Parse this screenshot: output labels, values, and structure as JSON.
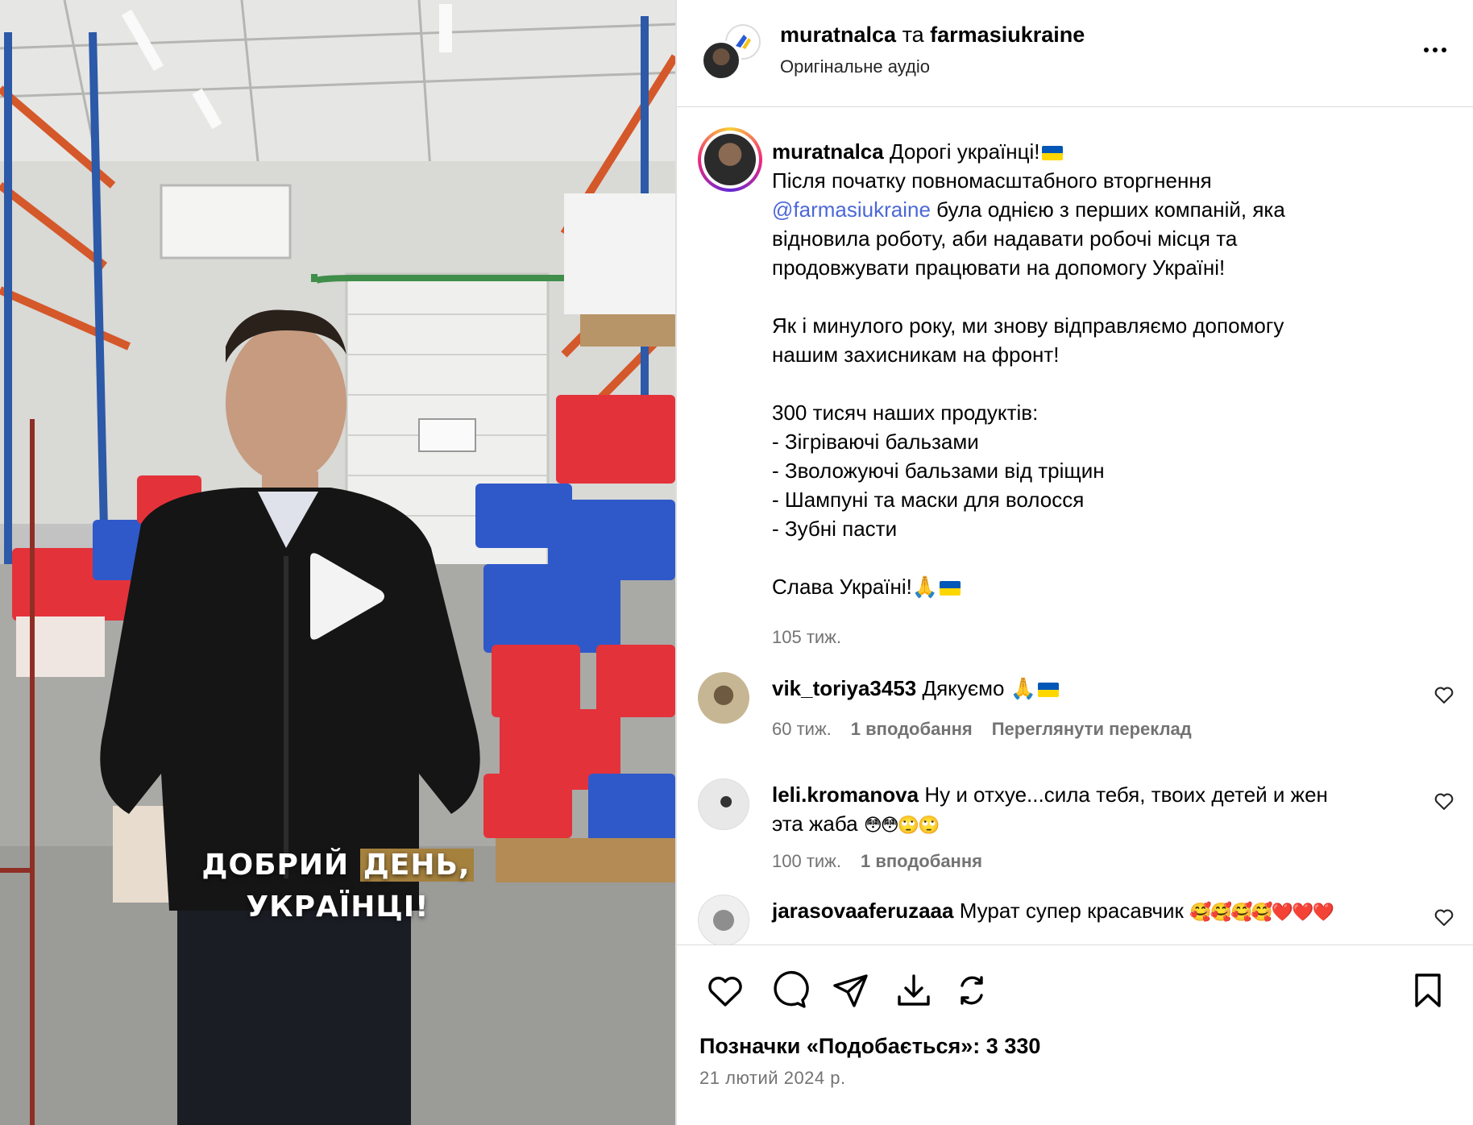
{
  "video": {
    "caption_line1_a": "ДОБРИЙ ",
    "caption_line1_b": "ДЕНЬ,",
    "caption_line2": "УКРАЇНЦІ!"
  },
  "header": {
    "author": "muratnalca",
    "separator": " та ",
    "collaborator": "farmasiukraine",
    "audio": "Оригінальне аудіо"
  },
  "post_caption": {
    "username": "muratnalca",
    "lines": [
      "Дорогі українці!",
      "Після початку повномасштабного вторгнення",
      "@farmasiukraine",
      " була однією з перших компаній, яка",
      "відновила роботу, аби надавати робочі місця та",
      "продовжувати працювати на допомогу Україні!",
      "",
      "Як і минулого року, ми знову відправляємо допомогу",
      "нашим захисникам на фронт!",
      "",
      "300 тисяч наших продуктів:",
      "- Зігріваючі бальзами",
      "- Зволожуючі бальзами від тріщин",
      "- Шампуні та маски для волосся",
      "- Зубні пасти",
      "",
      "Слава Україні!"
    ],
    "time": "105 тиж."
  },
  "comments": [
    {
      "username": "vik_toriya3453",
      "text": "Дякуємо",
      "time": "60 тиж.",
      "likes": "1 вподобання",
      "translate": "Переглянути переклад"
    },
    {
      "username": "leli.kromanova",
      "text_line1": "Ну и отхуе...сила тебя, твоих детей и жен",
      "text_line2": "эта жаба",
      "emoji": "😳😳🙄🙄",
      "time": "100 тиж.",
      "likes": "1 вподобання"
    },
    {
      "username": "jarasovaaferuzaaa",
      "text": "Мурат супер красавчик",
      "emoji": "🥰🥰🥰🥰❤️❤️❤️"
    }
  ],
  "actions": {
    "likes_label": "Позначки «Подобається»: 3 330",
    "date": "21 лютий 2024 р."
  },
  "icons": [
    "more-icon",
    "play-icon",
    "heart-icon",
    "comment-icon",
    "share-icon",
    "download-icon",
    "remix-icon",
    "bookmark-icon",
    "like-comment-icon",
    "verified-icon"
  ],
  "colors": {
    "link": "#4c68d7",
    "muted": "#737373",
    "flag_blue": "#0057b7",
    "flag_yellow": "#ffd700",
    "caption_highlight": "#a5813e"
  }
}
